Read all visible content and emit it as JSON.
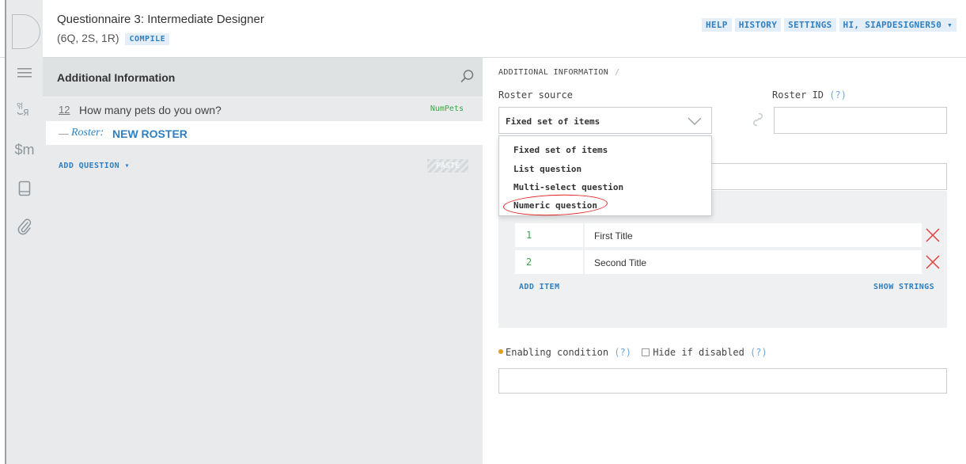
{
  "header": {
    "title": "Questionnaire 3: Intermediate Designer",
    "counts": "(6Q, 2S, 1R)",
    "compile_label": "COMPILE",
    "nav": [
      "HELP",
      "HISTORY",
      "SETTINGS",
      "HI, SIAPDESIGNER50 ▾"
    ]
  },
  "rail": {
    "icons": [
      "menu-icon",
      "translate-icon",
      "macros-icon",
      "book-icon",
      "attachment-icon"
    ],
    "macros_label": "$m",
    "translate_label": "얶​Я"
  },
  "tree": {
    "title": "Additional Information",
    "question": {
      "number": "12",
      "text": "How many pets do you own?",
      "variable": "NumPets"
    },
    "roster": {
      "dash": "—",
      "label": "Roster:",
      "name": "NEW ROSTER"
    },
    "add_question": "ADD QUESTION ▾",
    "paste": "PASTE"
  },
  "editor": {
    "breadcrumb": "ADDITIONAL INFORMATION",
    "breadcrumb_sep": "/",
    "roster_source_label": "Roster source",
    "roster_id_label": "Roster ID",
    "help_mark": "(?)",
    "selected_source": "Fixed set of items",
    "source_options": [
      "Fixed set of items",
      "List question",
      "Multi-select question",
      "Numeric question"
    ],
    "items": [
      {
        "index": "1",
        "title": "First Title"
      },
      {
        "index": "2",
        "title": "Second Title"
      }
    ],
    "add_item": "ADD ITEM",
    "show_strings": "SHOW STRINGS",
    "enabling_condition_label": "Enabling condition",
    "hide_if_disabled_label": "Hide if disabled"
  },
  "colors": {
    "accent": "#2f7fc1",
    "variable_green": "#3aa64a",
    "delete_red": "#e04040",
    "annotation_red": "#e02020"
  }
}
